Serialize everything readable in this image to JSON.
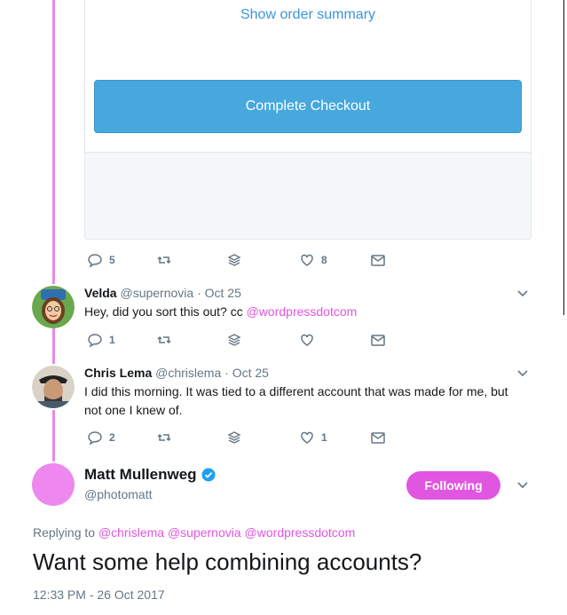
{
  "card": {
    "order_summary_label": "Show order summary",
    "checkout_label": "Complete Checkout"
  },
  "tweets": [
    {
      "actions": {
        "replies": "5",
        "likes": "8"
      }
    },
    {
      "name": "Velda",
      "handle": "@supernovia",
      "time": "· Oct 25",
      "text": "Hey, did you sort this out? cc ",
      "mention": "@wordpressdotcom",
      "actions": {
        "replies": "1",
        "likes": ""
      }
    },
    {
      "name": "Chris Lema",
      "handle": "@chrislema",
      "time": "· Oct 25",
      "text_line1": "I did this morning. It was tied to a different account that was made for me, but",
      "text_line2": "not one I knew of.",
      "actions": {
        "replies": "2",
        "likes": "1"
      }
    }
  ],
  "main_tweet": {
    "name": "Matt Mullenweg",
    "handle": "@photomatt",
    "follow_label": "Following",
    "replying_prefix": "Replying to ",
    "replying_to": [
      "@chrislema",
      "@supernovia",
      "@wordpressdotcom"
    ],
    "text": "Want some help combining accounts?",
    "timestamp": "12:33 PM - 26 Oct 2017"
  },
  "colors": {
    "accent": "#e056e0",
    "thread_line": "#e88ae8",
    "checkout_button": "#46a8dd",
    "link_blue": "#3b94d9",
    "muted": "#657786"
  },
  "icons": [
    "reply-icon",
    "retweet-icon",
    "stack-icon",
    "heart-icon",
    "mail-icon",
    "chevron-down-icon",
    "verified-badge-icon"
  ]
}
